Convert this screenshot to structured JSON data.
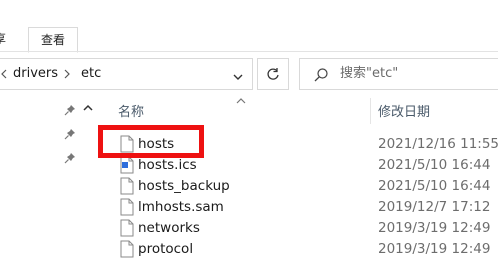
{
  "ribbon": {
    "tabs": [
      {
        "label": "享"
      },
      {
        "label": "查看"
      }
    ]
  },
  "address_bar": {
    "crumbs": [
      {
        "label": "drivers"
      },
      {
        "label": "etc"
      }
    ]
  },
  "search": {
    "placeholder": "搜索\"etc\""
  },
  "columns": {
    "name": "名称",
    "date_modified": "修改日期"
  },
  "files": [
    {
      "name": "hosts",
      "date": "2021/12/16 11:55",
      "icon": "file-icon"
    },
    {
      "name": "hosts.ics",
      "date": "2021/5/10 16:44",
      "icon": "ics-file-icon"
    },
    {
      "name": "hosts_backup",
      "date": "2021/5/10 16:44",
      "icon": "file-icon"
    },
    {
      "name": "lmhosts.sam",
      "date": "2019/12/7 17:12",
      "icon": "file-icon"
    },
    {
      "name": "networks",
      "date": "2019/3/19 12:49",
      "icon": "file-icon"
    },
    {
      "name": "protocol",
      "date": "2019/3/19 12:49",
      "icon": "file-icon"
    }
  ],
  "annotation": {
    "color": "#ee1111",
    "target": "hosts"
  }
}
